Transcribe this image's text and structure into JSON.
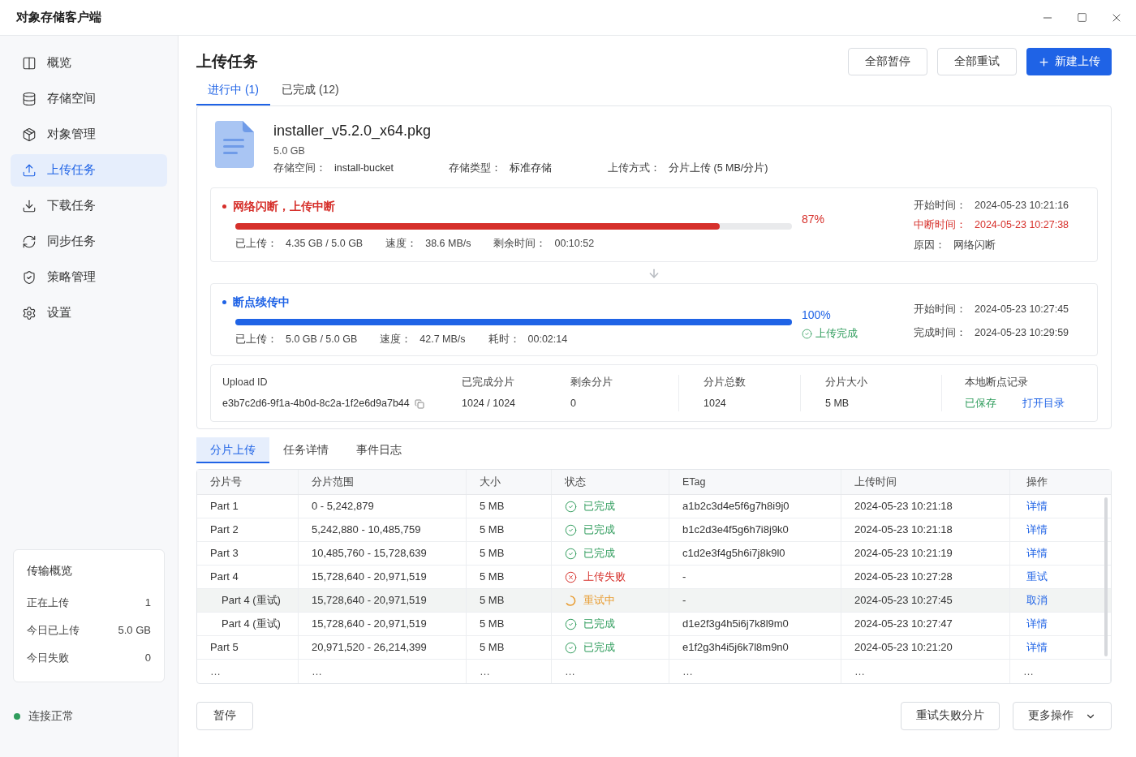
{
  "window": {
    "title": "对象存储客户端"
  },
  "sidebar": {
    "items": [
      {
        "label": "概览",
        "kind": "overview",
        "selected": false
      },
      {
        "label": "存储空间",
        "kind": "storage",
        "selected": false
      },
      {
        "label": "对象管理",
        "kind": "objects",
        "selected": false
      },
      {
        "label": "上传任务",
        "kind": "upload",
        "selected": true
      },
      {
        "label": "下载任务",
        "kind": "download",
        "selected": false
      },
      {
        "label": "同步任务",
        "kind": "sync",
        "selected": false
      },
      {
        "label": "策略管理",
        "kind": "policy",
        "selected": false
      },
      {
        "label": "设置",
        "kind": "settings",
        "selected": false
      }
    ],
    "summary": {
      "title": "传输概览",
      "rows": [
        {
          "label": "正在上传",
          "value": "1"
        },
        {
          "label": "今日已上传",
          "value": "5.0 GB"
        },
        {
          "label": "今日失败",
          "value": "0"
        }
      ]
    },
    "connection": {
      "text": "连接正常",
      "connected": true
    }
  },
  "page": {
    "title": "上传任务",
    "buttons": [
      {
        "label": "全部暂停",
        "kind": "secondary"
      },
      {
        "label": "全部重试",
        "kind": "secondary"
      },
      {
        "label": "新建上传",
        "kind": "primary"
      }
    ],
    "tabs": [
      {
        "label": "进行中 (1)",
        "selected": true
      },
      {
        "label": "已完成 (12)",
        "selected": false
      }
    ]
  },
  "file": {
    "name": "installer_v5.2.0_x64.pkg",
    "size": "5.0 GB",
    "meta": [
      {
        "label": "存储空间：",
        "value": "install-bucket"
      },
      {
        "label": "存储类型：",
        "value": "标准存储"
      },
      {
        "label": "上传方式：",
        "value": "分片上传 (5 MB/分片)"
      }
    ]
  },
  "stages": [
    {
      "kind": "interrupted",
      "title": "网络闪断，上传中断",
      "level": 0.87,
      "percent": "87%",
      "stats": [
        {
          "label": "已上传：",
          "value": "4.35 GB / 5.0 GB"
        },
        {
          "label": "速度：",
          "value": "38.6 MB/s"
        },
        {
          "label": "剩余时间：",
          "value": "00:10:52"
        }
      ],
      "times": [
        {
          "label": "开始时间：",
          "value": "2024-05-23 10:21:16",
          "alert": false
        },
        {
          "label": "中断时间：",
          "value": "2024-05-23 10:27:38",
          "alert": true
        },
        {
          "label": "原因：",
          "value": "网络闪断",
          "alert": false
        }
      ]
    },
    {
      "kind": "resuming",
      "title": "断点续传中",
      "level": 1,
      "percent": "100%",
      "result": "上传完成",
      "stats": [
        {
          "label": "已上传：",
          "value": "5.0 GB / 5.0 GB"
        },
        {
          "label": "速度：",
          "value": "42.7 MB/s"
        },
        {
          "label": "耗时：",
          "value": "00:02:14"
        }
      ],
      "times": [
        {
          "label": "开始时间：",
          "value": "2024-05-23 10:27:45",
          "alert": false
        },
        {
          "label": "完成时间：",
          "value": "2024-05-23 10:29:59",
          "alert": false
        }
      ]
    }
  ],
  "upload_info": {
    "upload_id": {
      "label": "Upload ID",
      "value": "e3b7c2d6-9f1a-4b0d-8c2a-1f2e6d9a7b44"
    },
    "fields": [
      {
        "label": "已完成分片",
        "value": "1024 / 1024"
      },
      {
        "label": "剩余分片",
        "value": "0"
      },
      {
        "label": "分片总数",
        "value": "1024"
      },
      {
        "label": "分片大小",
        "value": "5 MB"
      }
    ],
    "checkpoint": {
      "label": "本地断点记录",
      "status": "已保存",
      "link": "打开目录"
    }
  },
  "detail_tabs": [
    {
      "label": "分片上传",
      "selected": true
    },
    {
      "label": "任务详情",
      "selected": false
    },
    {
      "label": "事件日志",
      "selected": false
    }
  ],
  "table": {
    "columns": [
      "分片号",
      "分片范围",
      "大小",
      "状态",
      "ETag",
      "上传时间",
      "操作"
    ],
    "rows": [
      {
        "part": "Part 1",
        "range": "0 - 5,242,879",
        "size": "5 MB",
        "status": "已完成",
        "kind": "done",
        "etag": "a1b2c3d4e5f6g7h8i9j0",
        "time": "2024-05-23 10:21:18",
        "action": "详情",
        "selected": false
      },
      {
        "part": "Part 2",
        "range": "5,242,880 - 10,485,759",
        "size": "5 MB",
        "status": "已完成",
        "kind": "done",
        "etag": "b1c2d3e4f5g6h7i8j9k0",
        "time": "2024-05-23 10:21:18",
        "action": "详情",
        "selected": false
      },
      {
        "part": "Part 3",
        "range": "10,485,760 - 15,728,639",
        "size": "5 MB",
        "status": "已完成",
        "kind": "done",
        "etag": "c1d2e3f4g5h6i7j8k9l0",
        "time": "2024-05-23 10:21:19",
        "action": "详情",
        "selected": false
      },
      {
        "part": "Part 4",
        "range": "15,728,640 - 20,971,519",
        "size": "5 MB",
        "status": "上传失败",
        "kind": "failed",
        "etag": "-",
        "time": "2024-05-23 10:27:28",
        "action": "重试",
        "selected": false,
        "children": [
          {
            "part": "Part 4 (重试)",
            "range": "15,728,640 - 20,971,519",
            "size": "5 MB",
            "status": "重试中",
            "kind": "retrying",
            "etag": "-",
            "time": "2024-05-23 10:27:45",
            "action": "取消",
            "selected": true
          },
          {
            "part": "Part 4 (重试)",
            "range": "15,728,640 - 20,971,519",
            "size": "5 MB",
            "status": "已完成",
            "kind": "done",
            "etag": "d1e2f3g4h5i6j7k8l9m0",
            "time": "2024-05-23 10:27:47",
            "action": "详情",
            "selected": false
          }
        ]
      },
      {
        "part": "Part 5",
        "range": "20,971,520 - 26,214,399",
        "size": "5 MB",
        "status": "已完成",
        "kind": "done",
        "etag": "e1f2g3h4i5j6k7l8m9n0",
        "time": "2024-05-23 10:21:20",
        "action": "详情",
        "selected": false
      },
      {
        "kind": "more",
        "cells": [
          "…",
          "…",
          "…",
          "…",
          "…",
          "…",
          "…"
        ]
      }
    ]
  },
  "footer": {
    "left": [
      {
        "label": "暂停"
      }
    ],
    "right": [
      {
        "label": "重试失败分片",
        "dropdown": false
      },
      {
        "label": "更多操作",
        "dropdown": true
      }
    ]
  }
}
